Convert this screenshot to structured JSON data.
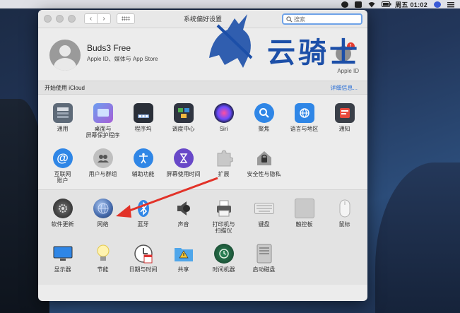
{
  "menubar": {
    "clock": "周五 01:02"
  },
  "window": {
    "title": "系统偏好设置",
    "nav": {
      "back": "‹",
      "forward": "›"
    },
    "search": {
      "placeholder": "搜索"
    }
  },
  "account": {
    "name": "Buds3 Free",
    "subtitle": "Apple ID、媒体与 App Store",
    "apple_id_label": "Apple ID",
    "badge": "1"
  },
  "icloud": {
    "label": "开始使用 iCloud",
    "details_button": "详细信息..."
  },
  "prefs": {
    "row1": [
      {
        "name": "general",
        "label": "通用"
      },
      {
        "name": "desktop",
        "label": "桌面与\n屏幕保护程序"
      },
      {
        "name": "dock",
        "label": "程序坞"
      },
      {
        "name": "mission-control",
        "label": "调度中心"
      },
      {
        "name": "siri",
        "label": "Siri"
      },
      {
        "name": "spotlight",
        "label": "聚焦"
      },
      {
        "name": "language",
        "label": "语言与地区"
      },
      {
        "name": "notifications",
        "label": "通知"
      }
    ],
    "row2": [
      {
        "name": "internet-accounts",
        "label": "互联网\n账户"
      },
      {
        "name": "users-groups",
        "label": "用户与群组"
      },
      {
        "name": "accessibility",
        "label": "辅助功能"
      },
      {
        "name": "screen-time",
        "label": "屏幕使用时间"
      },
      {
        "name": "extensions",
        "label": "扩展"
      },
      {
        "name": "security",
        "label": "安全性与隐私"
      }
    ],
    "row3": [
      {
        "name": "software-update",
        "label": "软件更新"
      },
      {
        "name": "network",
        "label": "网络"
      },
      {
        "name": "bluetooth",
        "label": "蓝牙"
      },
      {
        "name": "sound",
        "label": "声音"
      },
      {
        "name": "printers",
        "label": "打印机与\n扫描仪"
      },
      {
        "name": "keyboard",
        "label": "键盘"
      },
      {
        "name": "trackpad",
        "label": "触控板"
      },
      {
        "name": "mouse",
        "label": "鼠标"
      }
    ],
    "row4": [
      {
        "name": "displays",
        "label": "显示器"
      },
      {
        "name": "energy",
        "label": "节能"
      },
      {
        "name": "date-time",
        "label": "日期与时间"
      },
      {
        "name": "sharing",
        "label": "共享"
      },
      {
        "name": "time-machine",
        "label": "时间机器"
      },
      {
        "name": "startup-disk",
        "label": "启动磁盘"
      }
    ]
  },
  "watermark": {
    "text": "云骑士"
  },
  "colors": {
    "accent": "#2a6fd6",
    "arrow": "#e23228",
    "watermark": "#1c4fa8"
  }
}
